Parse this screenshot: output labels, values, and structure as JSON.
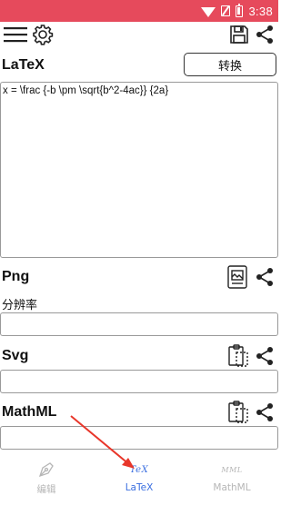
{
  "status_bar": {
    "time": "3:38",
    "icons": [
      "wifi-icon",
      "no-sim-icon",
      "battery-icon"
    ]
  },
  "toolbar": {
    "left_icons": [
      "menu-icon",
      "gear-icon"
    ],
    "right_icons": [
      "save-icon",
      "share-icon"
    ]
  },
  "latex": {
    "title": "LaTeX",
    "convert_label": "转换",
    "input_value": "x = \\frac {-b \\pm \\sqrt{b^2-4ac}} {2a}"
  },
  "png": {
    "title": "Png",
    "resolution_label": "分辨率",
    "resolution_value": "",
    "icons": [
      "image-save-icon",
      "share-icon"
    ]
  },
  "svg": {
    "title": "Svg",
    "value": "",
    "icons": [
      "clipboard-icon",
      "share-icon"
    ]
  },
  "mathml": {
    "title": "MathML",
    "value": "",
    "icons": [
      "clipboard-icon",
      "share-icon"
    ]
  },
  "bottom_nav": {
    "items": [
      {
        "label": "编辑",
        "icon": "pen-nib-icon",
        "active": false
      },
      {
        "label": "LaTeX",
        "icon": "tex-icon",
        "glyph": "TeX",
        "active": true
      },
      {
        "label": "MathML",
        "icon": "mml-icon",
        "glyph": "MML",
        "active": false
      }
    ]
  },
  "colors": {
    "status_bar": "#e64a5c",
    "active_tab": "#3b6fe0",
    "inactive_tab": "#b6b6b6",
    "annotation_arrow": "#e8362a"
  }
}
